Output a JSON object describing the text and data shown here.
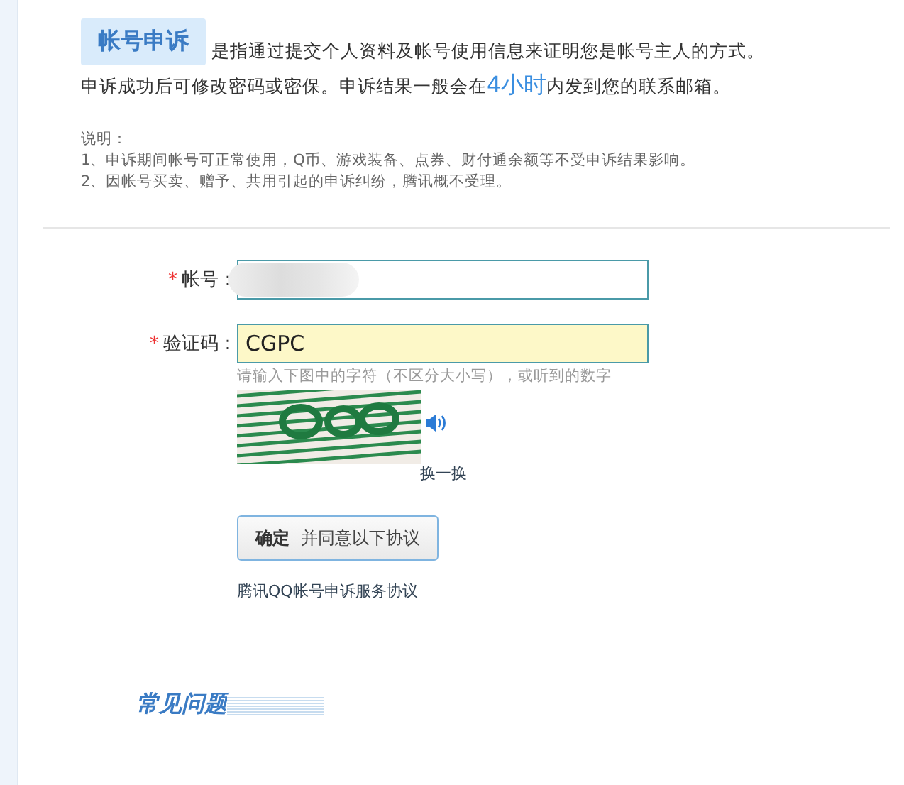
{
  "intro": {
    "badge": "帐号申诉",
    "line_1": "是指通过提交个人资料及帐号使用信息来证明您是帐号主人的方式。",
    "line_2_before": "申诉成功后可修改密码或密保。申诉结果一般会在",
    "highlight": "4小时",
    "line_2_after": "内发到您的联系邮箱。"
  },
  "notes": {
    "title": "说明：",
    "items": [
      "1、申诉期间帐号可正常使用，Q币、游戏装备、点券、财付通余额等不受申诉结果影响。",
      "2、因帐号买卖、赠予、共用引起的申诉纠纷，腾讯概不受理。"
    ]
  },
  "form": {
    "fields": [
      {
        "required_mark": "*",
        "label": "帐号：",
        "value_redacted": true,
        "focused": false
      },
      {
        "required_mark": "*",
        "label": "验证码：",
        "value": "CGPC",
        "focused": true
      }
    ],
    "hint": "请输入下图中的字符（不区分大小写），或听到的数字",
    "refresh": "换一换",
    "submit": {
      "bold": "确定",
      "rest": "并同意以下协议"
    },
    "agreement_link": "腾讯QQ帐号申诉服务协议"
  },
  "faq": {
    "title": "常见问题"
  }
}
